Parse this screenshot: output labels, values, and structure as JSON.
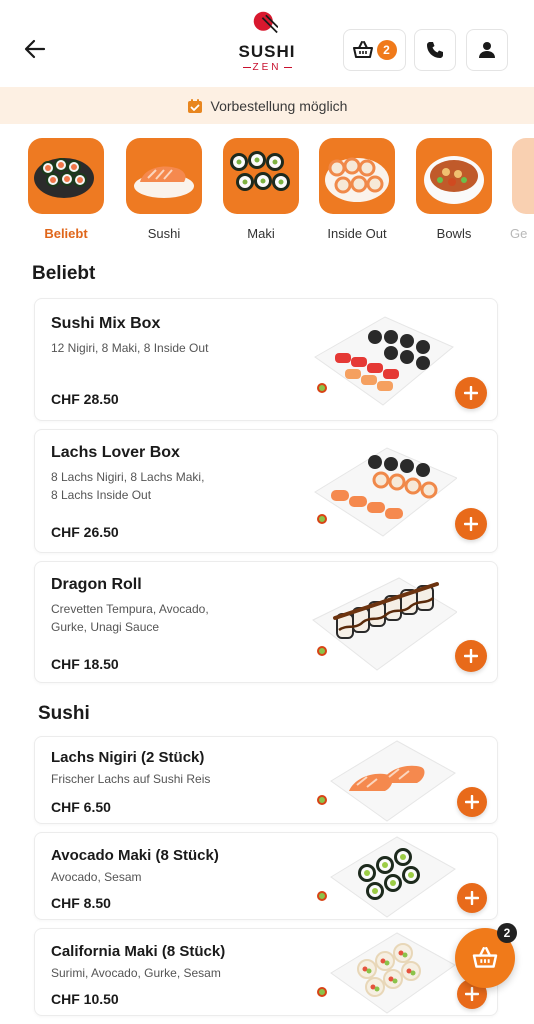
{
  "header": {
    "logo_title": "SUSHI",
    "logo_sub": "ZEN",
    "basket_count": "2"
  },
  "notice": {
    "text": "Vorbestellung möglich"
  },
  "categories": [
    {
      "label": "Beliebt",
      "active": true
    },
    {
      "label": "Sushi"
    },
    {
      "label": "Maki"
    },
    {
      "label": "Inside Out"
    },
    {
      "label": "Bowls"
    },
    {
      "label": "Ge"
    }
  ],
  "sections": {
    "beliebt": "Beliebt",
    "sushi": "Sushi"
  },
  "products": [
    {
      "name": "Sushi Mix Box",
      "desc": "12 Nigiri, 8 Maki, 8 Inside Out",
      "price": "CHF 28.50"
    },
    {
      "name": "Lachs Lover Box",
      "desc": "8 Lachs Nigiri, 8 Lachs Maki,\n8 Lachs Inside Out",
      "price": "CHF 26.50"
    },
    {
      "name": "Dragon Roll",
      "desc": "Crevetten Tempura, Avocado,\nGurke, Unagi Sauce",
      "price": "CHF 18.50"
    },
    {
      "name": "Lachs Nigiri (2 Stück)",
      "desc": "Frischer Lachs auf Sushi Reis",
      "price": "CHF 6.50"
    },
    {
      "name": "Avocado Maki (8 Stück)",
      "desc": "Avocado, Sesam",
      "price": "CHF 8.50"
    },
    {
      "name": "California Maki (8 Stück)",
      "desc": "Surimi, Avocado, Gurke, Sesam",
      "price": "CHF 10.50"
    }
  ],
  "cart_fab": {
    "count": "2"
  },
  "colors": {
    "accent": "#f07a1a",
    "notice_bg": "#fdf0e3",
    "logo_red": "#c8102e"
  }
}
